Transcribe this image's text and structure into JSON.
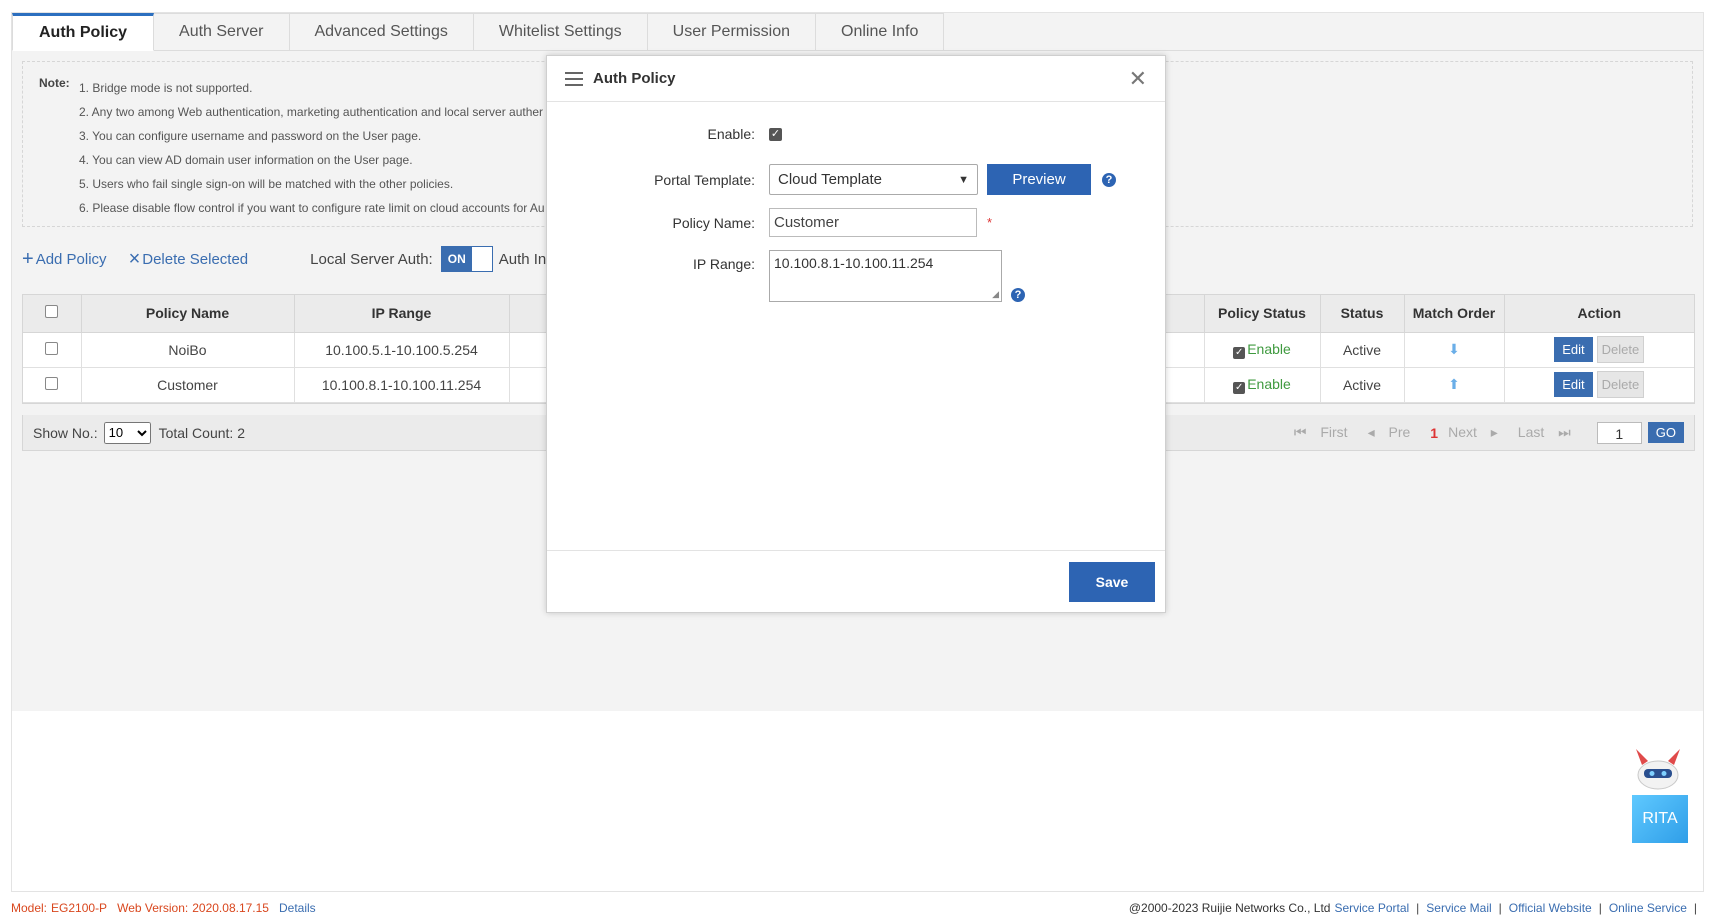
{
  "tabs": [
    {
      "label": "Auth Policy",
      "active": true
    },
    {
      "label": "Auth Server"
    },
    {
      "label": "Advanced Settings"
    },
    {
      "label": "Whitelist Settings"
    },
    {
      "label": "User Permission"
    },
    {
      "label": "Online Info"
    }
  ],
  "note": {
    "label": "Note:",
    "items": [
      "1. Bridge mode is not supported.",
      "2. Any two among Web authentication, marketing authentication and local server auther",
      "3. You can configure username and password on the User page.",
      "4. You can view AD domain user information on the User page.",
      "5. Users who fail single sign-on will be matched with the other policies.",
      "6. Please disable flow control if you want to configure rate limit on cloud accounts for Au"
    ]
  },
  "toolbar": {
    "add_policy": "Add Policy",
    "delete_selected": "Delete Selected",
    "local_server_auth": "Local Server Auth:",
    "toggle_on": "ON",
    "auth_inte": "Auth Inte"
  },
  "table": {
    "headers": [
      "Policy Name",
      "IP Range",
      "Policy Status",
      "Status",
      "Match Order",
      "Action"
    ],
    "rows": [
      {
        "name": "NoiBo",
        "ip": "10.100.5.1-10.100.5.254",
        "policy_status": "Enable",
        "status": "Active",
        "order": "down"
      },
      {
        "name": "Customer",
        "ip": "10.100.8.1-10.100.11.254",
        "policy_status": "Enable",
        "status": "Active",
        "order": "up"
      }
    ],
    "edit_label": "Edit",
    "delete_label": "Delete"
  },
  "pager": {
    "show_no": "Show No.:",
    "page_size": "10",
    "total": "Total Count: 2",
    "first": "First",
    "pre": "Pre",
    "current": "1",
    "next": "Next",
    "last": "Last",
    "page_input": "1",
    "go": "GO"
  },
  "modal": {
    "title": "Auth Policy",
    "enable_label": "Enable:",
    "portal_label": "Portal Template:",
    "portal_value": "Cloud Template",
    "preview": "Preview",
    "policy_name_label": "Policy Name:",
    "policy_name_value": "Customer",
    "required_mark": "*",
    "ip_range_label": "IP Range:",
    "ip_range_value": "10.100.8.1-10.100.11.254",
    "save": "Save"
  },
  "rita": {
    "label": "RITA"
  },
  "footer": {
    "model_label": "Model:",
    "model": "EG2100-P",
    "web_version_label": "Web Version:",
    "web_version": "2020.08.17.15",
    "details": "Details",
    "copyright": "@2000-2023 Ruijie Networks Co., Ltd",
    "links": [
      "Service Portal",
      "Service Mail",
      "Official Website",
      "Online Service"
    ]
  },
  "colors": {
    "accent": "#2d64b3",
    "enable_green": "#3f9a3f",
    "footer_red": "#d9471e"
  }
}
